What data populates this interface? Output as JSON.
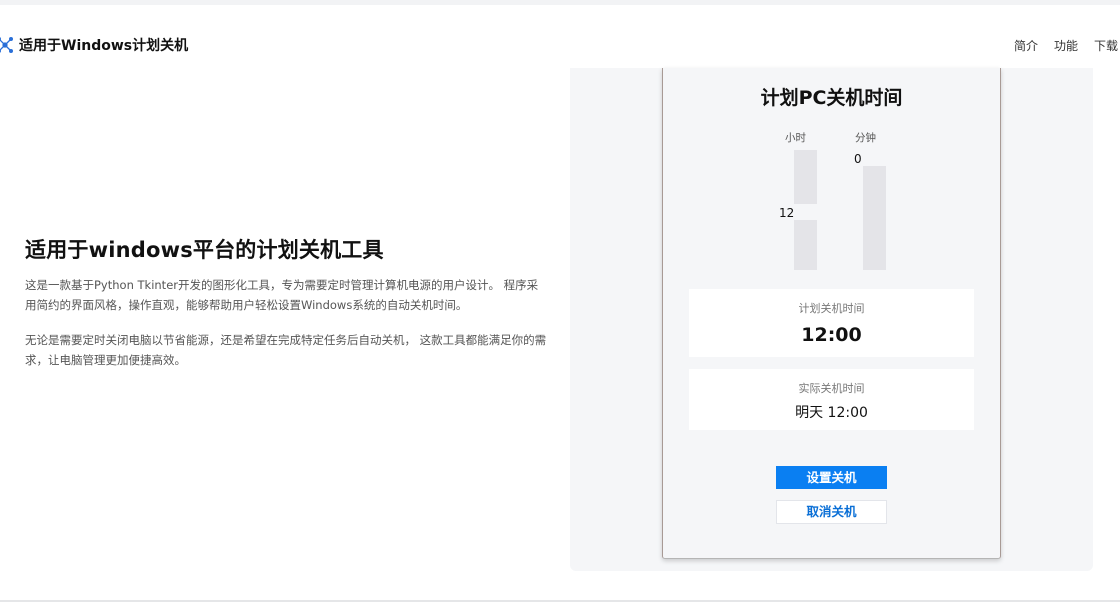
{
  "header": {
    "brand_icon": "network-nodes-icon",
    "brand_title": "适用于Windows计划关机",
    "nav": [
      {
        "label": "简介"
      },
      {
        "label": "功能"
      },
      {
        "label": "下载"
      }
    ]
  },
  "hero": {
    "title": "适用于windows平台的计划关机工具",
    "para1": "这是一款基于Python Tkinter开发的图形化工具，专为需要定时管理计算机电源的用户设计。 程序采用简约的界面风格，操作直观，能够帮助用户轻松设置Windows系统的自动关机时间。",
    "para2": "无论是需要定时关闭电脑以节省能源，还是希望在完成特定任务后自动关机， 这款工具都能满足你的需求，让电脑管理更加便捷高效。"
  },
  "app": {
    "title": "计划PC关机时间",
    "hour_label": "小时",
    "minute_label": "分钟",
    "hour_value": "12",
    "minute_value": "0",
    "scheduled_label": "计划关机时间",
    "scheduled_value": "12:00",
    "actual_label": "实际关机时间",
    "actual_value": "明天 12:00",
    "set_button": "设置关机",
    "cancel_button": "取消关机"
  },
  "colors": {
    "accent": "#0a7ff2",
    "page_bg": "#ffffff",
    "panel_bg": "#f5f6f8"
  }
}
